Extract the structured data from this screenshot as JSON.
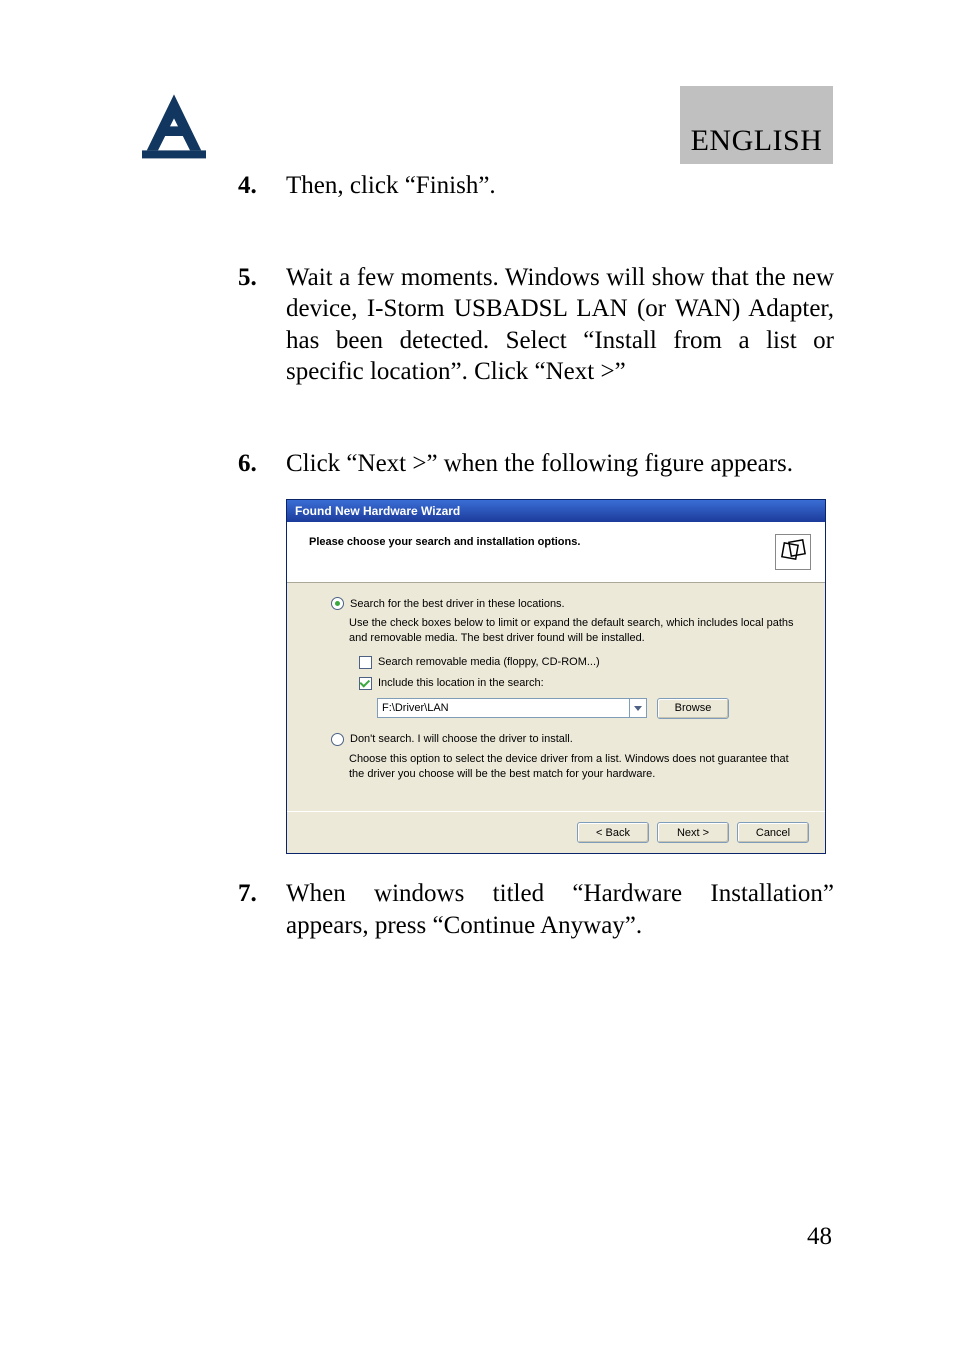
{
  "header": {
    "language_label": "ENGLISH"
  },
  "steps": [
    {
      "num": "4.",
      "text": "Then, click “Finish”."
    },
    {
      "num": "5.",
      "text": "Wait a few moments. Windows will show that the new device, I-Storm USBADSL LAN (or WAN) Adapter, has been detected. Select “Install from a list or specific location”. Click “Next >”"
    },
    {
      "num": "6.",
      "text": "Click “Next >” when the following figure appears."
    },
    {
      "num": "7.",
      "text": "When windows titled “Hardware Installation” appears, press “Continue Anyway”."
    }
  ],
  "dialog": {
    "title": "Found New Hardware Wizard",
    "heading": "Please choose your search and installation options.",
    "opt_search": {
      "label": "Search for the best driver in these locations.",
      "desc": "Use the check boxes below to limit or expand the default search, which includes local paths and removable media. The best driver found will be installed.",
      "cb_removable_label": "Search removable media (floppy, CD-ROM...)",
      "cb_include_label": "Include this location in the search:",
      "path_value": "F:\\Driver\\LAN",
      "browse_label": "Browse"
    },
    "opt_manual": {
      "label": "Don't search. I will choose the driver to install.",
      "desc": "Choose this option to select the device driver from a list.  Windows does not guarantee that the driver you choose will be the best match for your hardware."
    },
    "buttons": {
      "back": "< Back",
      "next": "Next >",
      "cancel": "Cancel"
    }
  },
  "page_number": "48"
}
